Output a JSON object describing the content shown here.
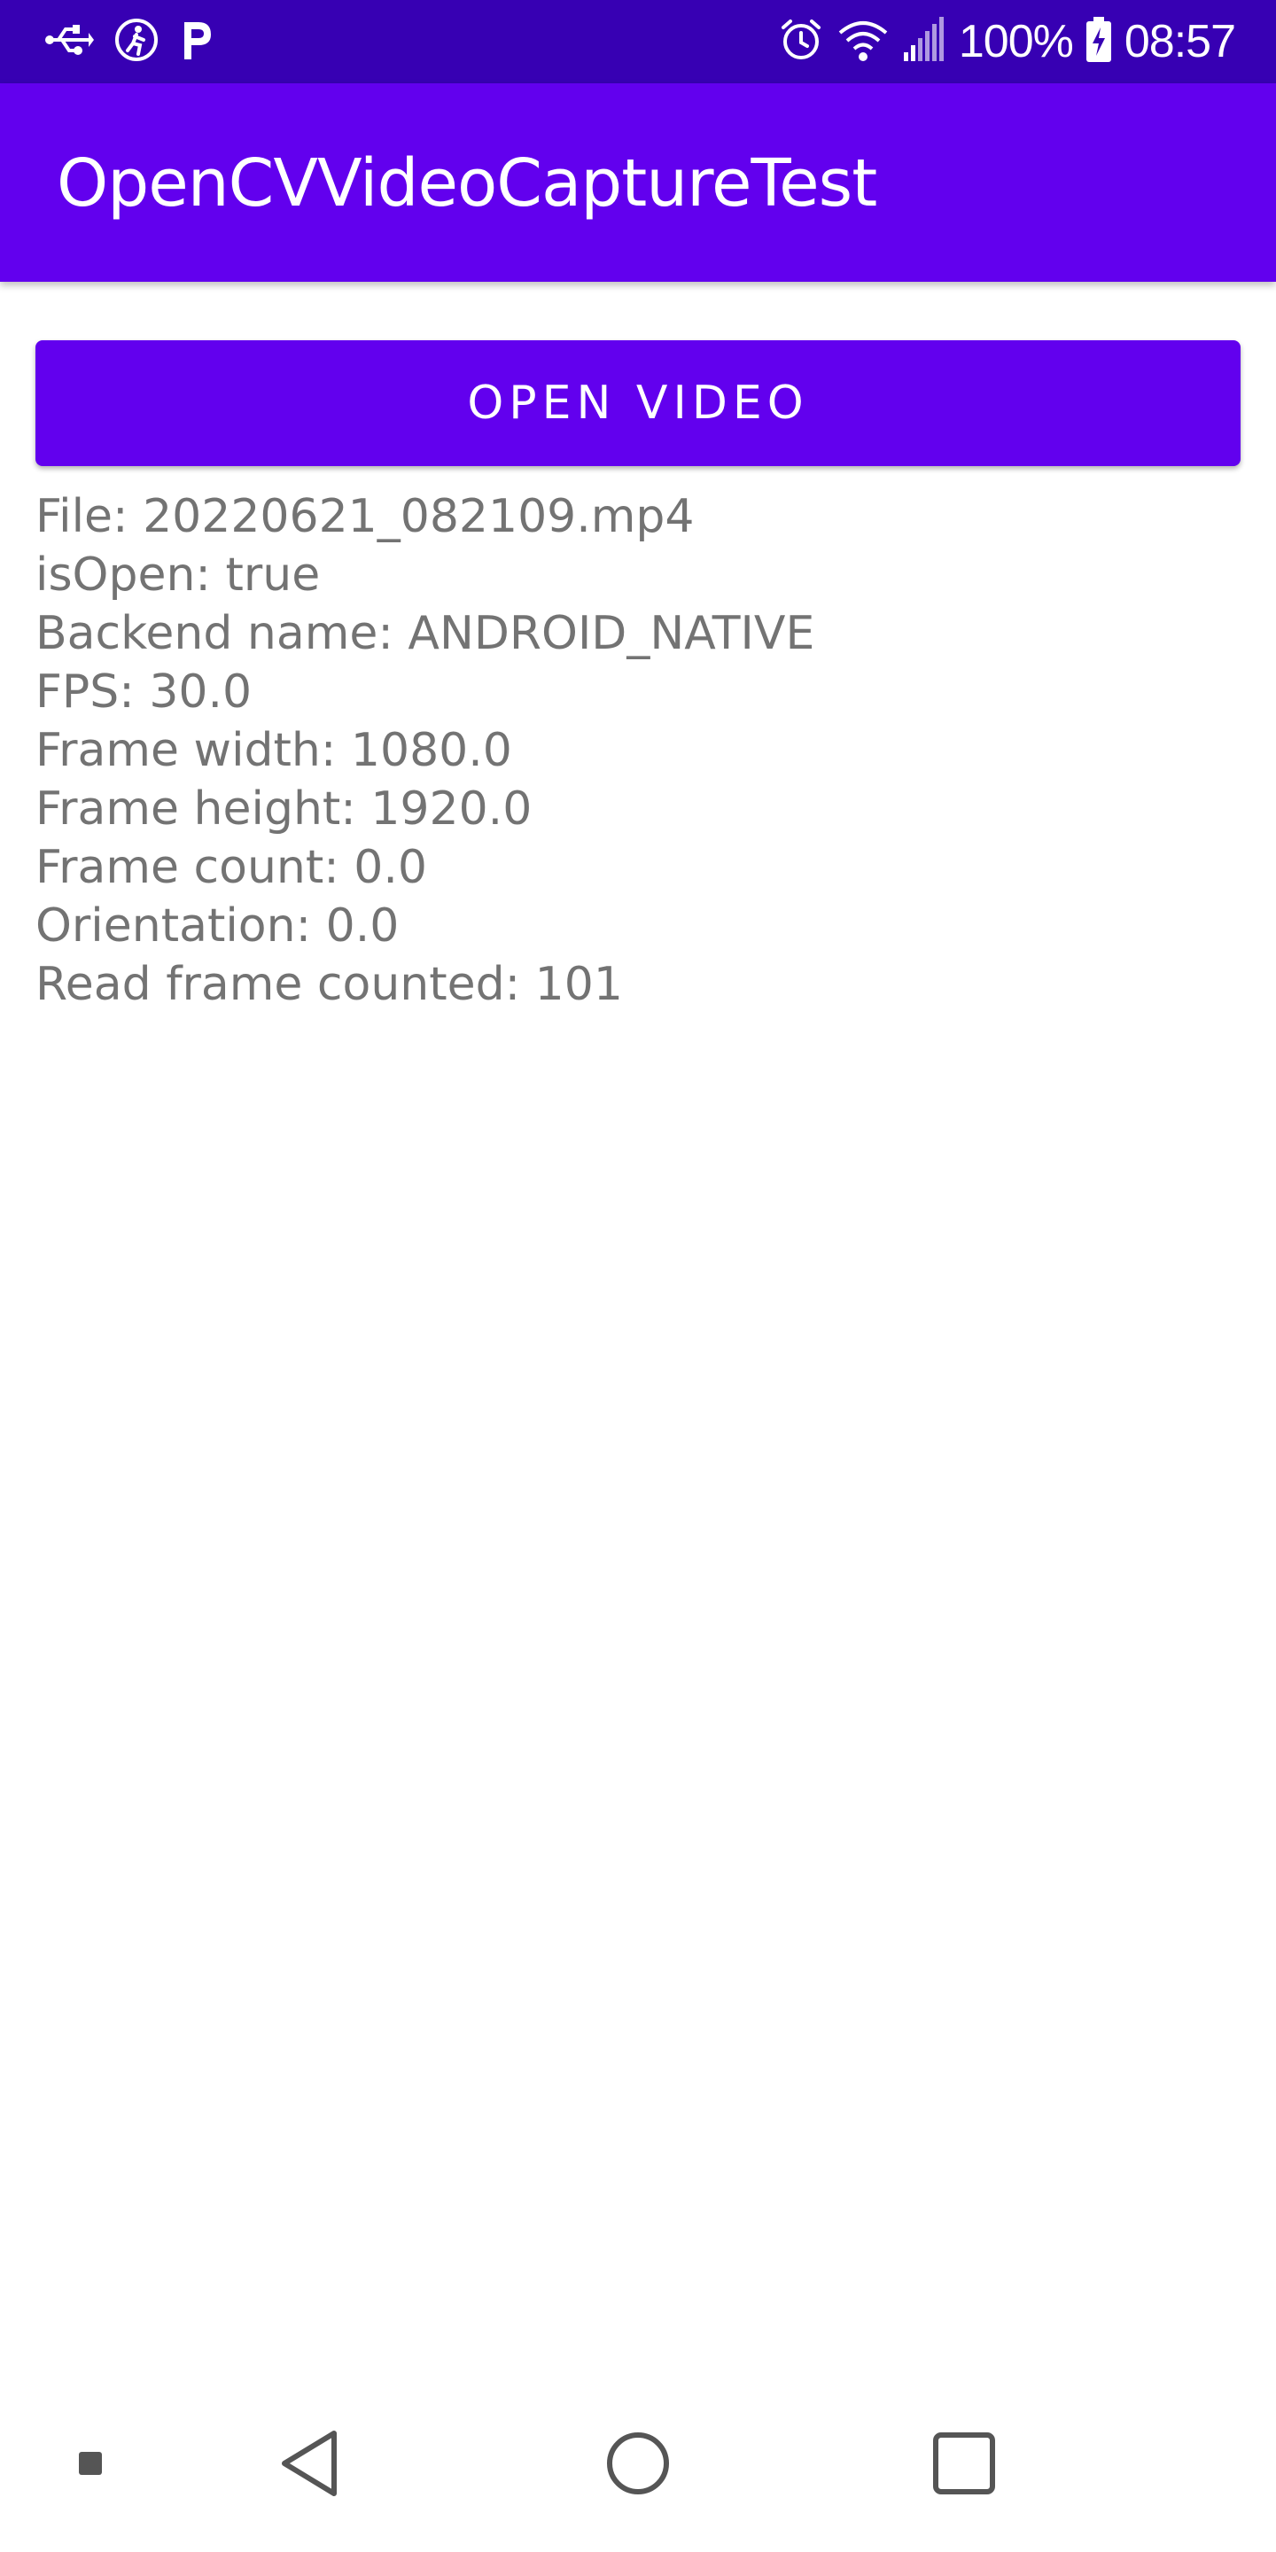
{
  "status_bar": {
    "icons_left": [
      "usb-icon",
      "accessibility-icon",
      "parking-icon"
    ],
    "icons_right": [
      "alarm-icon",
      "wifi-icon",
      "signal-icon",
      "battery-charging-icon"
    ],
    "battery": "100%",
    "time": "08:57"
  },
  "app_bar": {
    "title": "OpenCVVideoCaptureTest"
  },
  "main": {
    "open_button_label": "OPEN VIDEO",
    "info_lines": [
      "File: 20220621_082109.mp4",
      "isOpen: true",
      "Backend name: ANDROID_NATIVE",
      "FPS: 30.0",
      "Frame width: 1080.0",
      "Frame height: 1920.0",
      "Frame count: 0.0",
      "Orientation: 0.0",
      "Read frame counted: 101"
    ]
  },
  "nav_bar": {
    "items": [
      "menu-dot-icon",
      "back-icon",
      "home-icon",
      "recents-icon"
    ]
  },
  "colors": {
    "status_bar": "#3700b3",
    "primary": "#6200ee",
    "text_secondary": "#737373"
  }
}
